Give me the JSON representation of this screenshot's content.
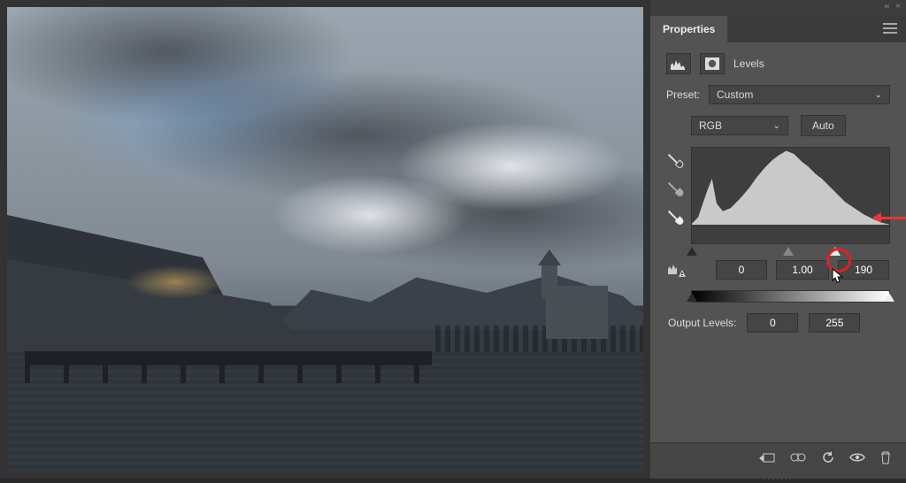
{
  "panel": {
    "title": "Properties",
    "adjustment_name": "Levels"
  },
  "preset": {
    "label": "Preset:",
    "value": "Custom"
  },
  "channel": {
    "value": "RGB"
  },
  "auto_label": "Auto",
  "input_levels": {
    "shadow": "0",
    "midtone": "1.00",
    "highlight": "190"
  },
  "output": {
    "label": "Output Levels:",
    "low": "0",
    "high": "255"
  },
  "chart_data": {
    "type": "area",
    "title": "",
    "xlabel": "",
    "ylabel": "",
    "xlim": [
      0,
      255
    ],
    "ylim": [
      0,
      100
    ],
    "x": [
      0,
      8,
      20,
      26,
      32,
      40,
      50,
      62,
      74,
      84,
      94,
      104,
      112,
      122,
      132,
      142,
      150,
      160,
      168,
      178,
      188,
      198,
      210,
      222,
      234,
      246,
      255
    ],
    "values": [
      2,
      10,
      45,
      60,
      28,
      18,
      22,
      34,
      48,
      62,
      74,
      84,
      90,
      96,
      92,
      82,
      76,
      66,
      60,
      50,
      40,
      30,
      22,
      14,
      8,
      3,
      1
    ]
  }
}
